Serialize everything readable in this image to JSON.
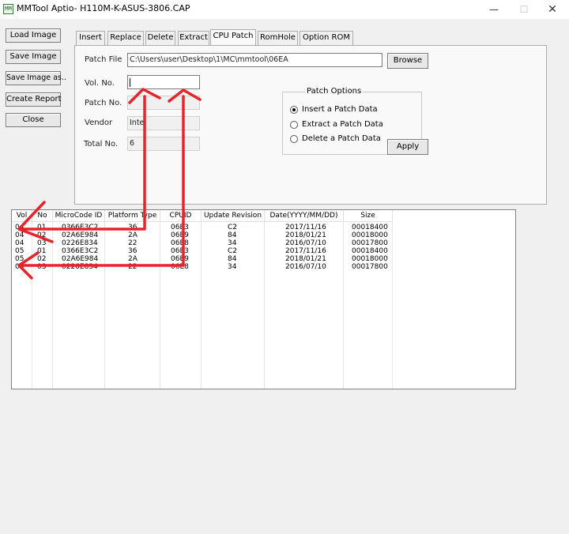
{
  "window": {
    "title": "MMTool Aptio- H110M-K-ASUS-3806.CAP",
    "app_icon": "MM",
    "min_glyph": "—",
    "max_glyph": "☐",
    "close_glyph": "✕"
  },
  "side_buttons": {
    "load_image": "Load Image",
    "save_image": "Save Image",
    "save_image_as": "Save Image as..",
    "create_report": "Create Report",
    "close": "Close"
  },
  "tabs": [
    "Insert",
    "Replace",
    "Delete",
    "Extract",
    "CPU Patch",
    "RomHole",
    "Option ROM"
  ],
  "active_tab": "CPU Patch",
  "patch": {
    "patch_file_label": "Patch File",
    "patch_file_value": "C:\\Users\\user\\Desktop\\1\\MC\\mmtool\\06EA",
    "browse_label": "Browse",
    "vol_no_label": "Vol. No.",
    "vol_no_value": "",
    "patch_no_label": "Patch No.",
    "patch_no_value": "",
    "vendor_label": "Vendor",
    "vendor_value": "Intel",
    "total_no_label": "Total No.",
    "total_no_value": "6"
  },
  "patch_options": {
    "title": "Patch Options",
    "options": [
      "Insert a Patch Data",
      "Extract a Patch Data",
      "Delete a Patch Data"
    ],
    "selected_index": 0,
    "apply_label": "Apply"
  },
  "table": {
    "columns": [
      "Vol",
      "No",
      "MicroCode ID",
      "Platform Type",
      "CPUID",
      "Update Revision",
      "Date(YYYY/MM/DD)",
      "Size"
    ],
    "rows": [
      [
        "04",
        "01",
        "0366E3C2",
        "36",
        "06E3",
        "C2",
        "2017/11/16",
        "00018400"
      ],
      [
        "04",
        "02",
        "02A6E984",
        "2A",
        "06E9",
        "84",
        "2018/01/21",
        "00018000"
      ],
      [
        "04",
        "03",
        "0226E834",
        "22",
        "06E8",
        "34",
        "2016/07/10",
        "00017800"
      ],
      [
        "05",
        "01",
        "0366E3C2",
        "36",
        "06E3",
        "C2",
        "2017/11/16",
        "00018400"
      ],
      [
        "05",
        "02",
        "02A6E984",
        "2A",
        "06E9",
        "84",
        "2018/01/21",
        "00018000"
      ],
      [
        "05",
        "03",
        "0226E834",
        "22",
        "06E8",
        "34",
        "2016/07/10",
        "00017800"
      ]
    ]
  },
  "annotation": {
    "color": "#e8232a"
  }
}
